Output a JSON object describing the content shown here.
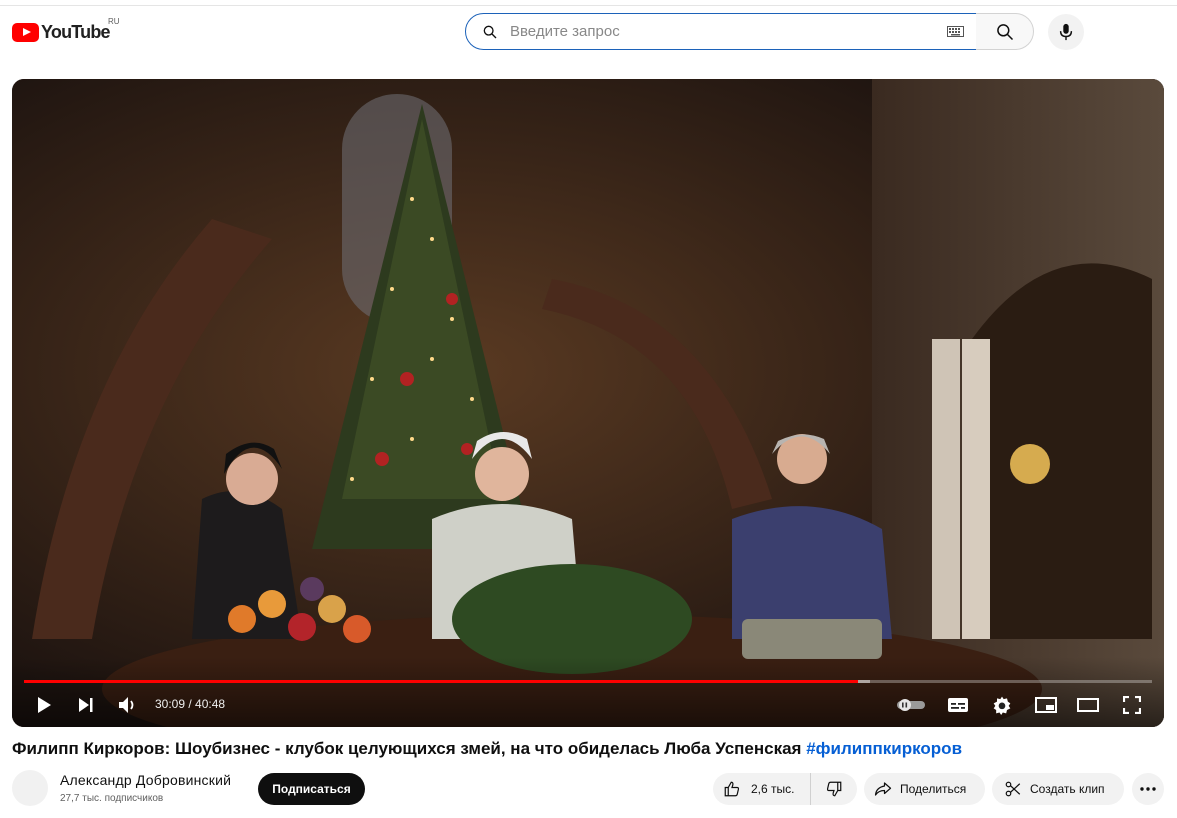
{
  "header": {
    "logo_text": "YouTube",
    "region": "RU",
    "search_placeholder": "Введите запрос",
    "icons": [
      "search-icon",
      "keyboard-icon",
      "mic-icon"
    ]
  },
  "player": {
    "current_time": "30:09",
    "duration": "40:48",
    "progress_played": 0.739,
    "progress_loaded": 0.75,
    "controls": [
      "play-icon",
      "next-icon",
      "volume-icon",
      "autoplay-toggle",
      "subtitles-icon",
      "settings-icon",
      "miniplayer-icon",
      "theater-icon",
      "fullscreen-icon"
    ]
  },
  "video": {
    "title": "Филипп Киркоров: Шоубизнес - клубок целующихся змей, на что обиделась Люба Успенская",
    "hashtag": "#филиппкиркоров"
  },
  "channel": {
    "name": "Александр Добровинский",
    "subscribers": "27,7 тыс. подписчиков",
    "subscribe_label": "Подписаться"
  },
  "actions": {
    "likes": "2,6 тыс.",
    "share_label": "Поделиться",
    "clip_label": "Создать клип"
  },
  "colors": {
    "accent": "#ff0000",
    "link": "#065fd4",
    "search_border": "#1c62b9"
  }
}
